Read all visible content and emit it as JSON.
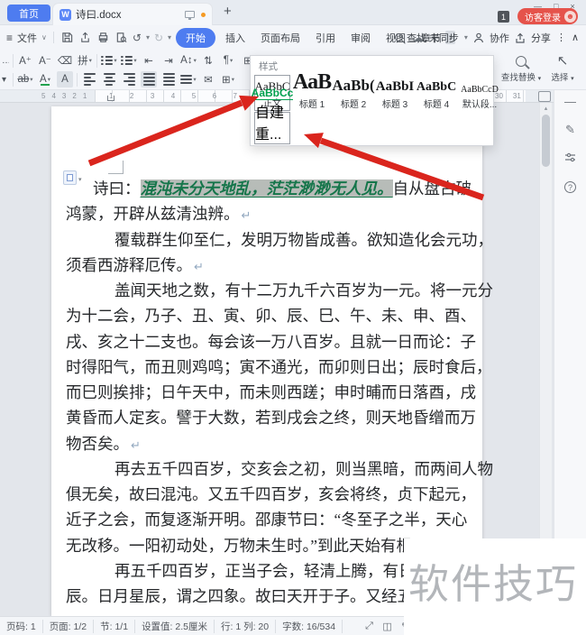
{
  "window": {
    "minimize": "—",
    "maximize": "□",
    "close": "×",
    "badge": "1",
    "login": "访客登录"
  },
  "tabbar": {
    "home": "首页",
    "logo": "W",
    "doc_title": "诗曰.docx",
    "new_tab": "+"
  },
  "icons": {
    "caret": "▾",
    "chevron": "∨",
    "hamburger": "≡",
    "cloud": "☁",
    "ellipsis": "⋮",
    "collapse": "∧",
    "undo": "↺",
    "redo": "↻",
    "more_caret": "▾",
    "overflow": "›",
    "scroll_up": "▴",
    "fullscreen": "⤢",
    "columns": "◫",
    "pen": "✎",
    "pageview": "▤",
    "outline": "≣",
    "web": "⊕",
    "eye": "◉",
    "dash": "—",
    "help": "?",
    "cursor": "↖"
  },
  "menubar": {
    "file": "文件",
    "items": [
      "开始",
      "插入",
      "页面布局",
      "引用",
      "审阅",
      "视图",
      "章节"
    ],
    "search": "查找",
    "sync": "未同步",
    "collab": "协作",
    "share": "分享"
  },
  "toolbar": {
    "grow": "A⁺",
    "shrink": "A⁻",
    "clear": "⌫",
    "pinyin": "拼",
    "outdent": "⇤",
    "indent": "⇥",
    "scale": "A↕",
    "sort": "⇅",
    "marks": "¶",
    "grid": "⊞",
    "strike": "ab",
    "fontcolor": "A",
    "highlight": "A",
    "shading": "✉",
    "borders": "⊞",
    "find_replace": "查找替换",
    "select": "选择"
  },
  "styles_panel": {
    "title": "样式",
    "items": [
      {
        "preview": "AaBbC",
        "label": "正文"
      },
      {
        "preview": "AaB",
        "label": "标题 1"
      },
      {
        "preview": "AaBb(",
        "label": "标题 2"
      },
      {
        "preview": "AaBbI",
        "label": "标题 3"
      },
      {
        "preview": "AaBbC",
        "label": "标题 4"
      },
      {
        "preview": "AaBbCcD",
        "label": "默认段..."
      }
    ],
    "custom": {
      "preview": "AaBbCc",
      "label": "自建重..."
    }
  },
  "ruler": {
    "left": [
      "5",
      "4",
      "3",
      "2",
      "1"
    ],
    "mid": [
      "1",
      "2",
      "3",
      "4",
      "5",
      "6",
      "7"
    ],
    "far": [
      "30",
      "31"
    ]
  },
  "doc": {
    "lines": [
      {
        "pre": "诗曰：",
        "sel": "混沌未分天地乱，茫茫渺渺无人见。",
        "post": "自从盘古破"
      },
      {
        "text": "鸿蒙，开辟从兹清浊辨。",
        "mark": "↵"
      },
      {
        "text": "覆载群生仰至仁，发明万物皆成善。欲知造化会元功，"
      },
      {
        "text": "须看西游释厄传。",
        "mark": "↵"
      },
      {
        "text": "盖闻天地之数，有十二万九千六百岁为一元。将一元分"
      },
      {
        "text": "为十二会，乃子、丑、寅、卯、辰、巳、午、未、申、酉、"
      },
      {
        "text": "戌、亥之十二支也。每会该一万八百岁。且就一日而论：子"
      },
      {
        "text": "时得阳气，而丑则鸡鸣；寅不通光，而卯则日出；辰时食后，"
      },
      {
        "text": "而巳则挨排；日午天中，而未则西蹉；申时晡而日落酉，戌"
      },
      {
        "text": "黄昏而人定亥。譬于大数，若到戌会之终，则天地昏缯而万"
      },
      {
        "text": "物否矣。",
        "mark": "↵"
      },
      {
        "text": "再去五千四百岁，交亥会之初，则当黑暗，而两间人物"
      },
      {
        "text": "俱无矣，故曰混沌。又五千四百岁，亥会将终，贞下起元，"
      },
      {
        "text": "近子之会，而复逐渐开明。邵康节曰：“冬至子之半，天心"
      },
      {
        "text": "无改移。一阳初动处，万物未生时。”到此天始有根。",
        "mark": "↵"
      },
      {
        "text": "再五千四百岁，正当子会，轻清上腾，有日有月"
      },
      {
        "text": "辰。日月星辰，谓之四象。故曰天开于子。又经五千四"
      }
    ]
  },
  "statusbar": {
    "items": [
      "页码: 1",
      "页面: 1/2",
      "节: 1/1",
      "设置值: 2.5厘米",
      "行: 1  列: 20",
      "字数: 16/534"
    ]
  },
  "watermark": "软件技巧",
  "colors": {
    "accent": "#4e7cf0",
    "style_green": "#00a04e",
    "selection_green": "#15754a",
    "arrow_red": "#da251d",
    "login_red": "#e5534b"
  }
}
